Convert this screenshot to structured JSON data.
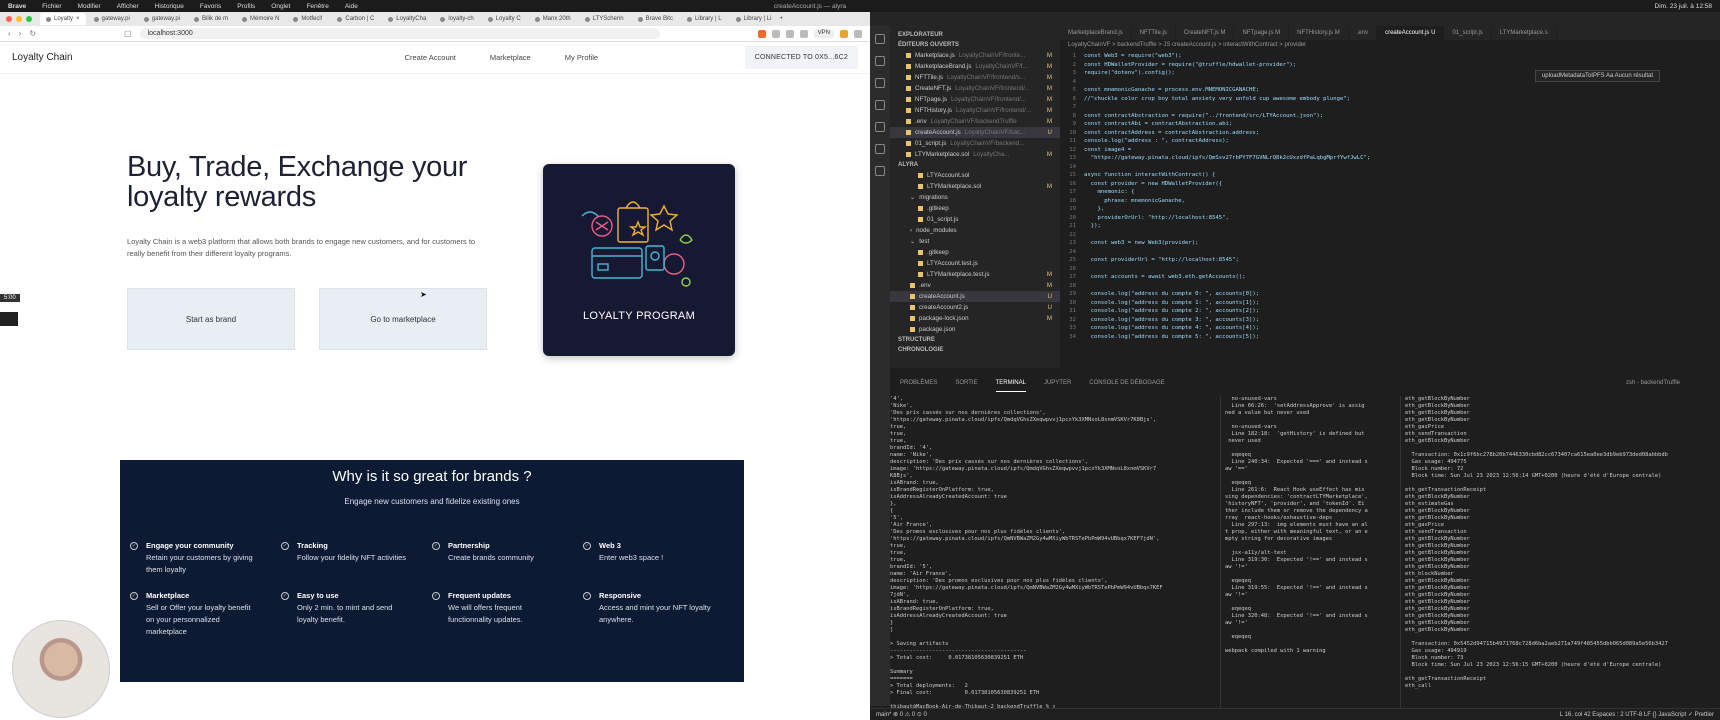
{
  "menubar": {
    "app": "Brave",
    "items": [
      "Fichier",
      "Modifier",
      "Afficher",
      "Historique",
      "Favoris",
      "Profils",
      "Onglet",
      "Fenêtre",
      "Aide"
    ],
    "clock": "Dim. 23 juil. à 12:58",
    "window_title": "createAccount.js — alyra"
  },
  "browser": {
    "tabs": [
      "Loyalty",
      "gateway.pi",
      "gateway.pi",
      "Bilik de m",
      "Mémoire N",
      "Motfecl!",
      "Carbon | C",
      "LoyaltyCha",
      "loyalty-ch",
      "Loyalty C",
      "Manx 20th",
      "LTYScherin",
      "Brave Bitc",
      "Library | L",
      "Library | Li"
    ],
    "url": "localhost:3000",
    "vpn": "VPN"
  },
  "site": {
    "logo": "Loyalty Chain",
    "nav": [
      "Create Account",
      "Marketplace",
      "My Profile"
    ],
    "connect": "CONNECTED TO 0X5...6C2",
    "hero_title": "Buy, Trade, Exchange your loyalty rewards",
    "hero_desc": "Loyalty Chain is a web3 platform that allows both brands to engage new customers, and for customers to really benefit from their different loyalty programs.",
    "btn_brand": "Start as brand",
    "btn_market": "Go to marketplace",
    "promo_caption": "LOYALTY PROGRAM",
    "features_title": "Why is it so great for brands ?",
    "features_sub": "Engage new customers and fidelize existing ones",
    "features": [
      {
        "title": "Engage your community",
        "desc": "Retain your customers by giving them loyalty"
      },
      {
        "title": "Tracking",
        "desc": "Follow your fidelity NFT activities"
      },
      {
        "title": "Partnership",
        "desc": "Create brands community"
      },
      {
        "title": "Web 3",
        "desc": "Enter web3 space !"
      },
      {
        "title": "Marketplace",
        "desc": "Sell or Offer your loyalty benefit on your personnalized marketplace"
      },
      {
        "title": "Easy to use",
        "desc": "Only 2 min. to mint and send loyalty benefit."
      },
      {
        "title": "Frequent updates",
        "desc": "We will offers frequent functionnality updates."
      },
      {
        "title": "Responsive",
        "desc": "Access and mint your NFT loyalty anywhere."
      }
    ],
    "side_time": "5:00"
  },
  "vscode": {
    "sidebar_explorer": "EXPLORATEUR",
    "open_editors": "ÉDITEURS OUVERTS",
    "open_files": [
      {
        "name": "Marketplace.js",
        "path": "LoyaltyChainVF/fronte...",
        "mark": "M"
      },
      {
        "name": "MarketplaceBrand.js",
        "path": "LoyaltyChainVF/f...",
        "mark": "M"
      },
      {
        "name": "NFTTile.js",
        "path": "LoyaltyChainVF/frontend/s...",
        "mark": "M"
      },
      {
        "name": "CreateNFT.js",
        "path": "LoyaltyChainVF/frontend/...",
        "mark": "M"
      },
      {
        "name": "NFTpage.js",
        "path": "LoyaltyChainVF/frontend/...",
        "mark": "M"
      },
      {
        "name": "NFTHistory.js",
        "path": "LoyaltyChainVF/frontend/...",
        "mark": "M"
      },
      {
        "name": ".env",
        "path": "LoyaltyChainVF/backendTruffle",
        "mark": "M"
      },
      {
        "name": "createAccount.js",
        "path": "LoyaltyChainVF/bac...",
        "mark": "U"
      },
      {
        "name": "01_script.js",
        "path": "LoyaltyChainVF/backend...",
        "mark": ""
      },
      {
        "name": "LTYMarketplace.sol",
        "path": "LoyaltyCha...",
        "mark": "M"
      }
    ],
    "workspace": "ALYRA",
    "tree": [
      {
        "name": "LTYAccount.sol",
        "mark": ""
      },
      {
        "name": "LTYMarketplace.sol",
        "mark": "M"
      },
      {
        "name": "migrations",
        "mark": ""
      },
      {
        "name": ".gitkeep",
        "mark": ""
      },
      {
        "name": "01_script.js",
        "mark": ""
      },
      {
        "name": "node_modules",
        "mark": ""
      },
      {
        "name": "test",
        "mark": ""
      },
      {
        "name": ".gitkeep",
        "mark": ""
      },
      {
        "name": "LTYAccount.test.js",
        "mark": ""
      },
      {
        "name": "LTYMarketplace.test.js",
        "mark": "M"
      },
      {
        "name": ".env",
        "mark": "M"
      },
      {
        "name": "createAccount.js",
        "mark": "U"
      },
      {
        "name": "createAccount2.js",
        "mark": "U"
      },
      {
        "name": "package-lock.json",
        "mark": "M"
      },
      {
        "name": "package.json",
        "mark": ""
      }
    ],
    "structure": "STRUCTURE",
    "timeline": "CHRONOLOGIE",
    "editor_tabs": [
      "MarketplaceBrand.js",
      "NFTTile.js",
      "CreateNFT.js M",
      "NFTpage.js M",
      "NFTHistory.js M",
      ".env",
      "createAccount.js U",
      "01_script.js",
      "LTYMarketplace.s"
    ],
    "breadcrumbs": "LoyaltyChainVF > backendTruffle > JS createAccount.js > interactWithContract > provider",
    "find": "uploadMetadataToIPFS  Aa  Aucun résultat",
    "code": [
      {
        "n": "1",
        "t": "const Web3 = require(\"web3\");"
      },
      {
        "n": "2",
        "t": "const HDWalletProvider = require(\"@truffle/hdwallet-provider\");"
      },
      {
        "n": "3",
        "t": "require(\"dotenv\").config();"
      },
      {
        "n": "4",
        "t": ""
      },
      {
        "n": "5",
        "t": "const mnemonicGanache = process.env.MNEMONICGANACHE;"
      },
      {
        "n": "6",
        "t": "//\"chuckle color crop boy total anxiety very unfold cup awesome embody plunge\";"
      },
      {
        "n": "7",
        "t": ""
      },
      {
        "n": "8",
        "t": "const contractAbstraction = require(\"../frontend/src/LTYAccount.json\");"
      },
      {
        "n": "9",
        "t": "const contractAbi = contractAbstraction.abi;"
      },
      {
        "n": "10",
        "t": "const contractAddress = contractAbstraction.address;"
      },
      {
        "n": "11",
        "t": "console.log(\"address : \", contractAddress);"
      },
      {
        "n": "12",
        "t": "const image4 ="
      },
      {
        "n": "13",
        "t": "  \"https://gateway.pinata.cloud/ipfs/QmSsv27rbPY7F7GVNLrQ8k2cUxzdfPaLqbgMprfYwfJwLC\";"
      },
      {
        "n": "14",
        "t": ""
      },
      {
        "n": "15",
        "t": "async function interactWithContract() {"
      },
      {
        "n": "16",
        "t": "  const provider = new HDWalletProvider({"
      },
      {
        "n": "17",
        "t": "    mnemonic: {"
      },
      {
        "n": "18",
        "t": "      phrase: mnemonicGanache,"
      },
      {
        "n": "19",
        "t": "    },"
      },
      {
        "n": "20",
        "t": "    providerOrUrl: \"http://localhost:8545\","
      },
      {
        "n": "21",
        "t": "  });"
      },
      {
        "n": "22",
        "t": ""
      },
      {
        "n": "23",
        "t": "  const web3 = new Web3(provider);"
      },
      {
        "n": "24",
        "t": ""
      },
      {
        "n": "25",
        "t": "  const providerUrl = \"http://localhost:8545\";"
      },
      {
        "n": "26",
        "t": ""
      },
      {
        "n": "27",
        "t": "  const accounts = await web3.eth.getAccounts();"
      },
      {
        "n": "28",
        "t": ""
      },
      {
        "n": "29",
        "t": "  console.log(\"address du compte 0: \", accounts[0]);"
      },
      {
        "n": "30",
        "t": "  console.log(\"address du compte 1: \", accounts[1]);"
      },
      {
        "n": "31",
        "t": "  console.log(\"address du compte 2: \", accounts[2]);"
      },
      {
        "n": "32",
        "t": "  console.log(\"address du compte 3: \", accounts[3]);"
      },
      {
        "n": "33",
        "t": "  console.log(\"address du compte 4: \", accounts[4]);"
      },
      {
        "n": "34",
        "t": "  console.log(\"address du compte 5: \", accounts[5]);"
      }
    ],
    "panel_tabs": [
      "PROBLÈMES",
      "SORTIE",
      "TERMINAL",
      "JUPYTER",
      "CONSOLE DE DÉBOGAGE"
    ],
    "terminal_name": "zsh - backendTruffle",
    "term1": "'4',\n'Nike',\n'Des prix cassés sur nos dernières collections',\n'https://gateway.pinata.cloud/ipfs/QmdqVGhsZXeqwpvvj1pcxYk3XMNsoL8xnmVSKVr7K8Bjs',\ntrue,\ntrue,\ntrue,\nbrandId: '4',\nname: 'Nike',\ndescription: 'Des prix cassés sur nos dernières collections',\nimage: 'https://gateway.pinata.cloud/ipfs/QmdqVGhsZXeqwpvvj1pcxYk3XMNsoL8xnmVSKVr7\nK8Bjs',\nisABrand: true,\nisBrandRegisterOnPlatform: true,\nisAddressAlreadyCreatedAccount: true\n},\n{\n'5',\n'Air France',\n'Des promos exclusives pour nos plus fidèles clients',\n'https://gateway.pinata.cloud/ipfs/QmNVBWaZM2Gy4wMXiyWbTRSTePbPmW94vUBbqx7KEF7jdN',\ntrue,\ntrue,\ntrue,\nbrandId: '5',\nname: 'Air France',\ndescription: 'Des promos exclusives pour nos plus fidèles clients',\nimage: 'https://gateway.pinata.cloud/ipfs/QmNVBWaZM2Gy4wMXiyWbTRSTePbPmW94vUBbqx7KEF\n7jdN',\nisABrand: true,\nisBrandRegisterOnPlatform: true,\nisAddressAlreadyCreatedAccount: true\n}\n]\n\n> Saving artifacts\n------------------------------------------\n> Total cost:     0.01738105630839251 ETH\n\nSummary\n=======\n> Total deployments:   2\n> Final cost:          0.01738105630839251 ETH\n\nthibaut@MacBook-Air-de-Thibaut-2 backendTruffle % ▯",
    "term2": "  no-unused-vars\n  Line 66:26:  'setAddressApprove' is assig\nned a value but never used\n\n  no-unused-vars\n  Line 182:18:  'getHistory' is defined but\n never used\n\n  eqeqeq\n  Line 240:34:  Expected '===' and instead s\naw '=='\n\n  eqeqeq\n  Line 261:6:  React Hook useEffect has mis\nsing dependencies: 'contractLTYMarketplace',\n'historyNFT', 'provider', and 'tokenId'. Ei\nther include them or remove the dependency a\nrray  react-hooks/exhaustive-deps\n  Line 297:13:  img elements must have an al\nt prop, either with meaningful text, or an e\nmpty string for decorative images\n\n  jsx-a11y/alt-text\n  Line 319:30:  Expected '!==' and instead s\naw '!='\n\n  eqeqeq\n  Line 319:55:  Expected '!==' and instead s\naw '!='\n\n  eqeqeq\n  Line 320:48:  Expected '!==' and instead s\naw '!='\n\n  eqeqeq\n\nwebpack compiled with 1 warning",
    "term3": "eth_getBlockByNumber\neth_getBlockByNumber\neth_getBlockByNumber\neth_getBlockByNumber\neth_gasPrice\neth_sendTransaction\neth_getBlockByNumber\n\n  Transaction: 0x1c9f6bc278b20b7446330cbd82cc673407ca615ea0ee3db9eb973ded08abbbdb\n  Gas usage: 494775\n  Block number: 72\n  Block time: Sun Jul 23 2023 12:56:14 GMT+0200 (heure d'été d'Europe centrale)\n\neth_getTransactionReceipt\neth_getBlockByNumber\neth_estimateGas\neth_getBlockByNumber\neth_getBlockByNumber\neth_gasPrice\neth_sendTransaction\neth_getBlockByNumber\neth_getBlockByNumber\neth_getBlockByNumber\neth_getBlockByNumber\neth_getBlockByNumber\neth_blockNumber\neth_getBlockByNumber\neth_getBlockByNumber\neth_getBlockByNumber\neth_getBlockByNumber\neth_getBlockByNumber\neth_getBlockByNumber\neth_getBlockByNumber\neth_getBlockByNumber\n\n  Transaction: 0x5452d94715b4971768c728d6ba2aeb271a749f485455dbb065d089a5e56b3427\n  Gas usage: 494919\n  Block number: 73\n  Block time: Sun Jul 23 2023 12:56:15 GMT+0200 (heure d'été d'Europe centrale)\n\neth_getTransactionReceipt\neth_call",
    "status_left": "main*  ⊗ 0 ⚠ 0  ⊙ 0",
    "status_right": "L 16, col 42   Espaces : 2   UTF-8   LF   {} JavaScript   ✓ Prettier"
  },
  "colors": {
    "navy": "#0d1a33",
    "card": "#171932",
    "accent_green": "#6a9955"
  }
}
